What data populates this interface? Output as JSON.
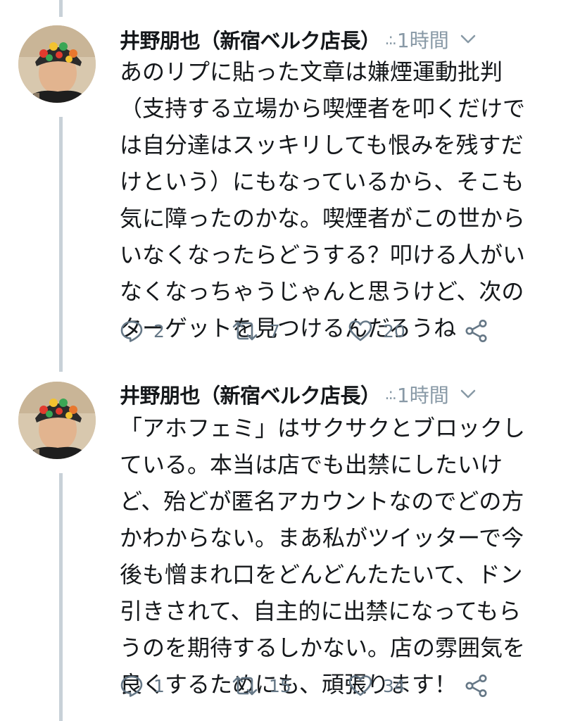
{
  "tweets": [
    {
      "author": "井野朋也（新宿ベルク店長）",
      "meta_dots": ".:.",
      "timestamp": "1時間",
      "lines": [
        "あのリプに貼った文章は嫌煙運動批判",
        "（支持する立場から喫煙者を叩くだけで",
        "は自分達はスッキリしても恨みを残すだ",
        "けという）にもなっているから、そこも",
        "気に障ったのかな。喫煙者がこの世から",
        "いなくなったらどうする？叩ける人がい",
        "なくなっちゃうじゃんと思うけど、次の",
        "ターゲットを見つけるんだろうね"
      ],
      "replies": "2",
      "retweets": "7",
      "likes": "20"
    },
    {
      "author": "井野朋也（新宿ベルク店長）",
      "meta_dots": ".:.",
      "timestamp": "1時間",
      "lines": [
        "「アホフェミ」はサクサクとブロックし",
        "ている。本当は店でも出禁にしたいけ",
        "ど、殆どが匿名アカウントなのでどの方",
        "かわからない。まあ私がツイッターで今",
        "後も憎まれ口をどんどんたたいて、ドン",
        "引きされて、自主的に出禁になってもら",
        "うのを期待するしかない。店の雰囲気を",
        "良くするためにも、頑張ります！"
      ],
      "replies": "1",
      "retweets": "15",
      "likes": "34"
    }
  ]
}
